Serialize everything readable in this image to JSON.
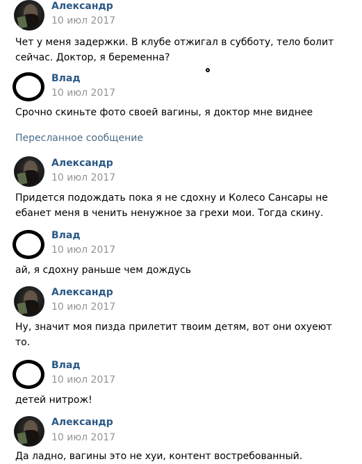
{
  "forwarded_label": "Пересланное сообщение",
  "messages": [
    {
      "author": "Александр",
      "date": "10 июл 2017",
      "text": "Чет у меня задержки. В клубе отжигал в субботу, тело болит сейчас. Доктор, я беременна?",
      "avatar": "photo-avatar"
    },
    {
      "author": "Влад",
      "date": "10 июл 2017",
      "text": "Срочно скиньте фото своей вагины, я доктор мне виднее",
      "avatar": "circle-avatar"
    },
    {
      "author": "Александр",
      "date": "10 июл 2017",
      "text": "Придется подождать пока я не сдохну и Колесо Сансары не ебанет меня в ченить ненужное за грехи мои. Тогда скину.",
      "avatar": "photo-avatar"
    },
    {
      "author": "Влад",
      "date": "10 июл 2017",
      "text": "ай, я сдохну раньше чем дождусь",
      "avatar": "circle-avatar"
    },
    {
      "author": "Александр",
      "date": "10 июл 2017",
      "text": "Ну, значит моя пизда прилетит твоим детям, вот они охуеют то.",
      "avatar": "photo-avatar"
    },
    {
      "author": "Влад",
      "date": "10 июл 2017",
      "text": "детей нитрож!",
      "avatar": "circle-avatar"
    },
    {
      "author": "Александр",
      "date": "10 июл 2017",
      "text": "Да ладно, вагины это не хуи, контент востребованный.",
      "avatar": "photo-avatar"
    }
  ],
  "colors": {
    "author_name": "#2a5885",
    "date": "#939393",
    "text": "#000000",
    "forwarded_label": "#4a6b8a"
  }
}
